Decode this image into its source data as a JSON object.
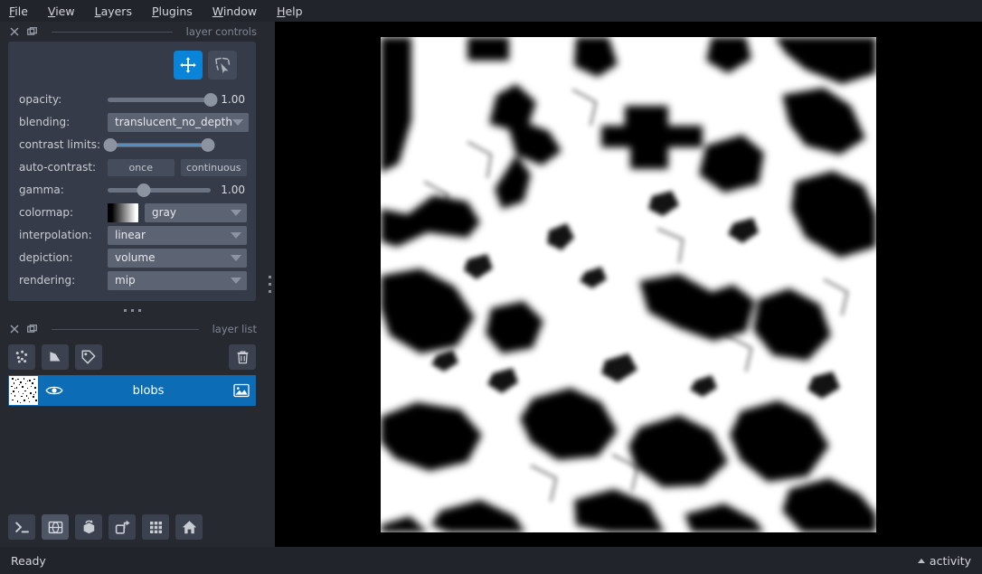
{
  "menubar": {
    "items": [
      {
        "pre": "",
        "mnemonic": "F",
        "post": "ile"
      },
      {
        "pre": "",
        "mnemonic": "V",
        "post": "iew"
      },
      {
        "pre": "",
        "mnemonic": "L",
        "post": "ayers"
      },
      {
        "pre": "",
        "mnemonic": "P",
        "post": "lugins"
      },
      {
        "pre": "",
        "mnemonic": "W",
        "post": "indow"
      },
      {
        "pre": "",
        "mnemonic": "H",
        "post": "elp"
      }
    ]
  },
  "docks": {
    "layer_controls_title": "layer controls",
    "layer_list_title": "layer list"
  },
  "controls": {
    "modes": [
      {
        "name": "pan-zoom-mode-button",
        "icon": "move-icon",
        "active": true
      },
      {
        "name": "transform-mode-button",
        "icon": "transform-icon",
        "active": false
      }
    ],
    "opacity": {
      "label": "opacity:",
      "value": "1.00",
      "percent": 100
    },
    "blending": {
      "label": "blending:",
      "value": "translucent_no_depth"
    },
    "contrast_limits": {
      "label": "contrast limits:",
      "low_percent": 0,
      "high_percent": 100
    },
    "auto_contrast": {
      "label": "auto-contrast:",
      "once": "once",
      "continuous": "continuous"
    },
    "gamma": {
      "label": "gamma:",
      "value": "1.00",
      "percent": 35
    },
    "colormap": {
      "label": "colormap:",
      "value": "gray"
    },
    "interpolation": {
      "label": "interpolation:",
      "value": "linear"
    },
    "depiction": {
      "label": "depiction:",
      "value": "volume"
    },
    "rendering": {
      "label": "rendering:",
      "value": "mip"
    }
  },
  "layer_list": {
    "toolbar": [
      {
        "name": "new-points-layer-button",
        "icon": "points-icon"
      },
      {
        "name": "new-shapes-layer-button",
        "icon": "shapes-icon"
      },
      {
        "name": "new-labels-layer-button",
        "icon": "labels-icon"
      },
      {
        "name": "delete-layer-button",
        "icon": "trash-icon"
      }
    ],
    "layers": [
      {
        "name": "blobs",
        "visible": true,
        "selected": true,
        "type_icon": "image-icon"
      }
    ]
  },
  "viewer_buttons": [
    {
      "name": "console-button",
      "icon": "console-icon",
      "active": false
    },
    {
      "name": "ndisplay-toggle-button",
      "icon": "cube-3d-icon",
      "active": true
    },
    {
      "name": "roll-dims-button",
      "icon": "roll-cube-icon",
      "active": false
    },
    {
      "name": "transpose-dims-button",
      "icon": "transpose-icon",
      "active": false
    },
    {
      "name": "grid-view-button",
      "icon": "grid-icon",
      "active": false
    },
    {
      "name": "home-button",
      "icon": "home-icon",
      "active": false
    }
  ],
  "statusbar": {
    "message": "Ready",
    "activity": "activity"
  },
  "colors": {
    "accent": "#0a84d8",
    "selection": "#0d6cb6",
    "panel": "#262930",
    "card": "#353b48",
    "canvas": "#000000"
  }
}
